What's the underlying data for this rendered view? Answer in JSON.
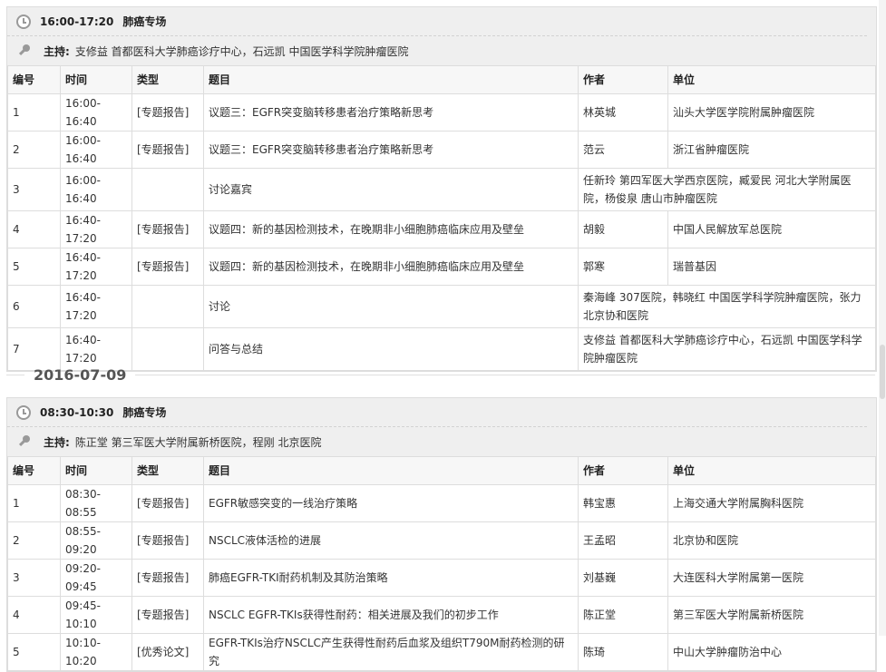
{
  "headers": [
    "编号",
    "时间",
    "类型",
    "题目",
    "作者",
    "单位"
  ],
  "host_label": "主持:",
  "sessions": [
    {
      "time": "16:00-17:20",
      "title": "肺癌专场",
      "host": "支修益 首都医科大学肺癌诊疗中心，石远凯 中国医学科学院肿瘤医院",
      "rows": [
        {
          "no": "1",
          "time": "16:00-16:40",
          "type": "[专题报告]",
          "topic": "议题三：EGFR突变脑转移患者治疗策略新思考",
          "author": "林英城",
          "unit": "汕头大学医学院附属肿瘤医院"
        },
        {
          "no": "2",
          "time": "16:00-16:40",
          "type": "[专题报告]",
          "topic": "议题三：EGFR突变脑转移患者治疗策略新思考",
          "author": "范云",
          "unit": "浙江省肿瘤医院"
        },
        {
          "no": "3",
          "time": "16:00-16:40",
          "type": "",
          "topic": "讨论嘉宾",
          "author": "任新玲 第四军医大学西京医院，臧爱民 河北大学附属医院，杨俊泉 唐山市肿瘤医院",
          "unit": ""
        },
        {
          "no": "4",
          "time": "16:40-17:20",
          "type": "[专题报告]",
          "topic": "议题四：新的基因检测技术，在晚期非小细胞肺癌临床应用及壁垒",
          "author": "胡毅",
          "unit": "中国人民解放军总医院"
        },
        {
          "no": "5",
          "time": "16:40-17:20",
          "type": "[专题报告]",
          "topic": "议题四：新的基因检测技术，在晚期非小细胞肺癌临床应用及壁垒",
          "author": "郭寒",
          "unit": "瑞普基因"
        },
        {
          "no": "6",
          "time": "16:40-17:20",
          "type": "",
          "topic": "讨论",
          "author": "秦海峰 307医院，韩晓红 中国医学科学院肿瘤医院，张力 北京协和医院",
          "unit": ""
        },
        {
          "no": "7",
          "time": "16:40-17:20",
          "type": "",
          "topic": "问答与总结",
          "author": "支修益 首都医科大学肺癌诊疗中心，石远凯 中国医学科学院肿瘤医院",
          "unit": ""
        }
      ]
    },
    {
      "time": "08:30-10:30",
      "title": "肺癌专场",
      "host": "陈正堂 第三军医大学附属新桥医院，程刚 北京医院",
      "rows": [
        {
          "no": "1",
          "time": "08:30-08:55",
          "type": "[专题报告]",
          "topic": "EGFR敏感突变的一线治疗策略",
          "author": "韩宝惠",
          "unit": "上海交通大学附属胸科医院"
        },
        {
          "no": "2",
          "time": "08:55-09:20",
          "type": "[专题报告]",
          "topic": "NSCLC液体活检的进展",
          "author": "王孟昭",
          "unit": "北京协和医院"
        },
        {
          "no": "3",
          "time": "09:20-09:45",
          "type": "[专题报告]",
          "topic": "肺癌EGFR-TKI耐药机制及其防治策略",
          "author": "刘基巍",
          "unit": "大连医科大学附属第一医院"
        },
        {
          "no": "4",
          "time": "09:45-10:10",
          "type": "[专题报告]",
          "topic": "NSCLC EGFR-TKIs获得性耐药：相关进展及我们的初步工作",
          "author": "陈正堂",
          "unit": "第三军医大学附属新桥医院"
        },
        {
          "no": "5",
          "time": "10:10-10:20",
          "type": "[优秀论文]",
          "topic": "EGFR-TKIs治疗NSCLC产生获得性耐药后血浆及组织T790M耐药检测的研究",
          "author": "陈琦",
          "unit": "中山大学肿瘤防治中心"
        }
      ]
    }
  ],
  "date_divider": "2016-07-09",
  "icons": {
    "clock": "clock-icon",
    "host": "microphone-icon"
  }
}
